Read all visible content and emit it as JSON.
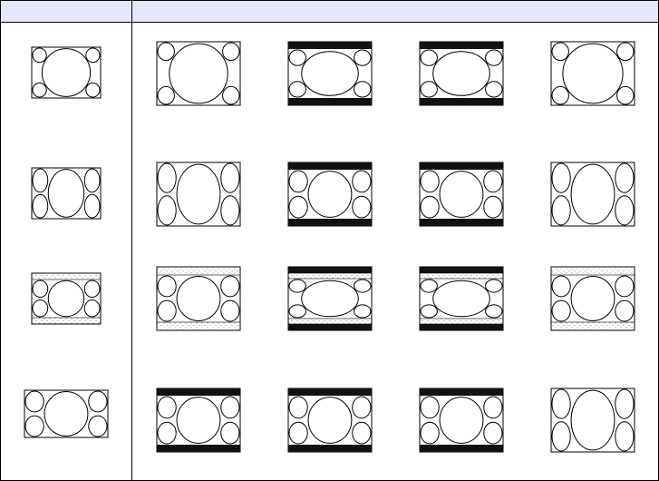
{
  "header": {
    "left_cell_text": "",
    "right_cell_text": ""
  },
  "colors": {
    "header_fill": "#e6e6fc",
    "line": "#000000",
    "bar": "#111111",
    "dots": "#555555"
  },
  "rows": [
    {
      "source": {
        "kind": "43",
        "bars": "none"
      },
      "outputs": [
        {
          "kind": "43",
          "bars": "none"
        },
        {
          "kind": "wide-squash",
          "bars": "black"
        },
        {
          "kind": "wide-squash",
          "bars": "black"
        },
        {
          "kind": "43-narrow",
          "bars": "none"
        }
      ]
    },
    {
      "source": {
        "kind": "tall",
        "bars": "none"
      },
      "outputs": [
        {
          "kind": "tall",
          "bars": "none"
        },
        {
          "kind": "wide",
          "bars": "black"
        },
        {
          "kind": "wide",
          "bars": "black"
        },
        {
          "kind": "tall",
          "bars": "none"
        }
      ]
    },
    {
      "source": {
        "kind": "wide",
        "bars": "dotted"
      },
      "outputs": [
        {
          "kind": "wide",
          "bars": "dotted"
        },
        {
          "kind": "wide-squash",
          "bars": "dotted-black"
        },
        {
          "kind": "wide-squash",
          "bars": "dotted-black"
        },
        {
          "kind": "wide",
          "bars": "dotted"
        }
      ]
    },
    {
      "source": {
        "kind": "wide",
        "bars": "none"
      },
      "outputs": [
        {
          "kind": "wide",
          "bars": "black"
        },
        {
          "kind": "wide",
          "bars": "black"
        },
        {
          "kind": "wide",
          "bars": "black"
        },
        {
          "kind": "tall",
          "bars": "none"
        }
      ]
    }
  ]
}
